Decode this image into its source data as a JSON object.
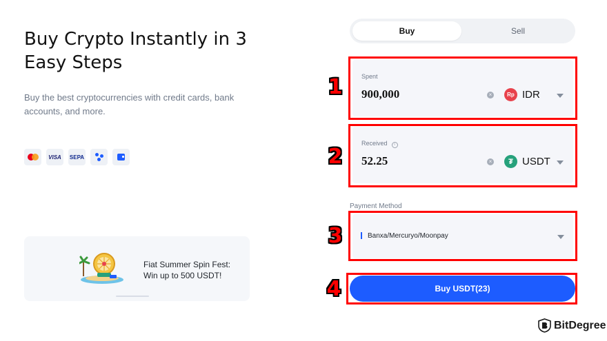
{
  "hero": {
    "title": "Buy Crypto Instantly in 3 Easy Steps",
    "subtitle": "Buy the best cryptocurrencies with credit cards, bank accounts, and more.",
    "payment_icons": [
      "mastercard-icon",
      "visa-icon",
      "sepa-icon",
      "dots-payment-icon",
      "wallet-icon"
    ],
    "visa_label": "VISA",
    "sepa_label": "SEPA"
  },
  "promo": {
    "line1": "Fiat Summer Spin Fest:",
    "line2": "Win up to 500 USDT!"
  },
  "tabs": {
    "buy": "Buy",
    "sell": "Sell",
    "active": "Buy"
  },
  "spent": {
    "label": "Spent",
    "value": "900,000",
    "currency": "IDR",
    "currency_symbol": "Rp"
  },
  "received": {
    "label": "Received",
    "info_icon": "i",
    "value": "52.25",
    "currency": "USDT",
    "currency_symbol": "₮"
  },
  "payment_method": {
    "label": "Payment Method",
    "value": "Banxa/Mercuryo/Moonpay"
  },
  "buy_button": {
    "label": "Buy USDT(23)"
  },
  "steps": [
    "1",
    "2",
    "3",
    "4"
  ],
  "watermark": {
    "text": "BitDegree"
  },
  "colors": {
    "accent": "#1d5cff",
    "highlight": "#ff0000",
    "idr": "#e8424c",
    "usdt": "#26a17b"
  }
}
